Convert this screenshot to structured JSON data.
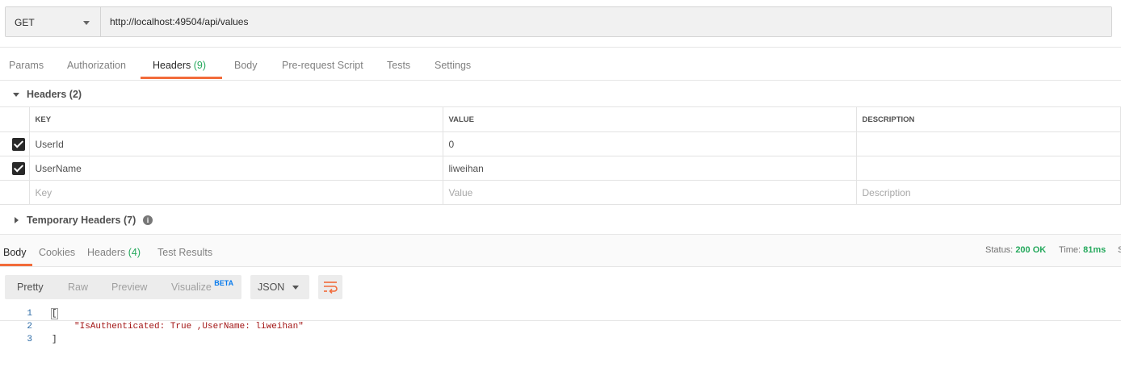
{
  "request": {
    "method": "GET",
    "url": "http://localhost:49504/api/values"
  },
  "request_tabs": [
    {
      "label": "Params",
      "count": ""
    },
    {
      "label": "Authorization",
      "count": ""
    },
    {
      "label": "Headers",
      "count": "(9)"
    },
    {
      "label": "Body",
      "count": ""
    },
    {
      "label": "Pre-request Script",
      "count": ""
    },
    {
      "label": "Tests",
      "count": ""
    },
    {
      "label": "Settings",
      "count": ""
    }
  ],
  "active_request_tab": "Headers",
  "headers_section": {
    "title": "Headers (2)",
    "columns": [
      "KEY",
      "VALUE",
      "DESCRIPTION"
    ],
    "rows": [
      {
        "checked": true,
        "key": "UserId",
        "value": "0",
        "description": ""
      },
      {
        "checked": true,
        "key": "UserName",
        "value": "liweihan",
        "description": ""
      }
    ],
    "placeholders": {
      "key": "Key",
      "value": "Value",
      "description": "Description"
    }
  },
  "temporary_headers": {
    "title": "Temporary Headers (7)"
  },
  "response_tabs": [
    {
      "label": "Body",
      "count": ""
    },
    {
      "label": "Cookies",
      "count": ""
    },
    {
      "label": "Headers",
      "count": "(4)"
    },
    {
      "label": "Test Results",
      "count": ""
    }
  ],
  "active_response_tab": "Body",
  "status": {
    "status_label": "Status:",
    "status_value": "200 OK",
    "time_label": "Time:",
    "time_value": "81ms",
    "size_label": "S"
  },
  "view_options": {
    "pretty": "Pretty",
    "raw": "Raw",
    "preview": "Preview",
    "visualize": "Visualize",
    "beta": "BETA",
    "format": "JSON"
  },
  "response_body": {
    "line_numbers": [
      "1",
      "2",
      "3"
    ],
    "line1": "[",
    "line2": "\"IsAuthenticated: True ,UserName: liweihan\"",
    "line3": "]"
  },
  "colors": {
    "accent": "#f26b3a",
    "success": "#26a95d",
    "beta": "#097bed"
  }
}
